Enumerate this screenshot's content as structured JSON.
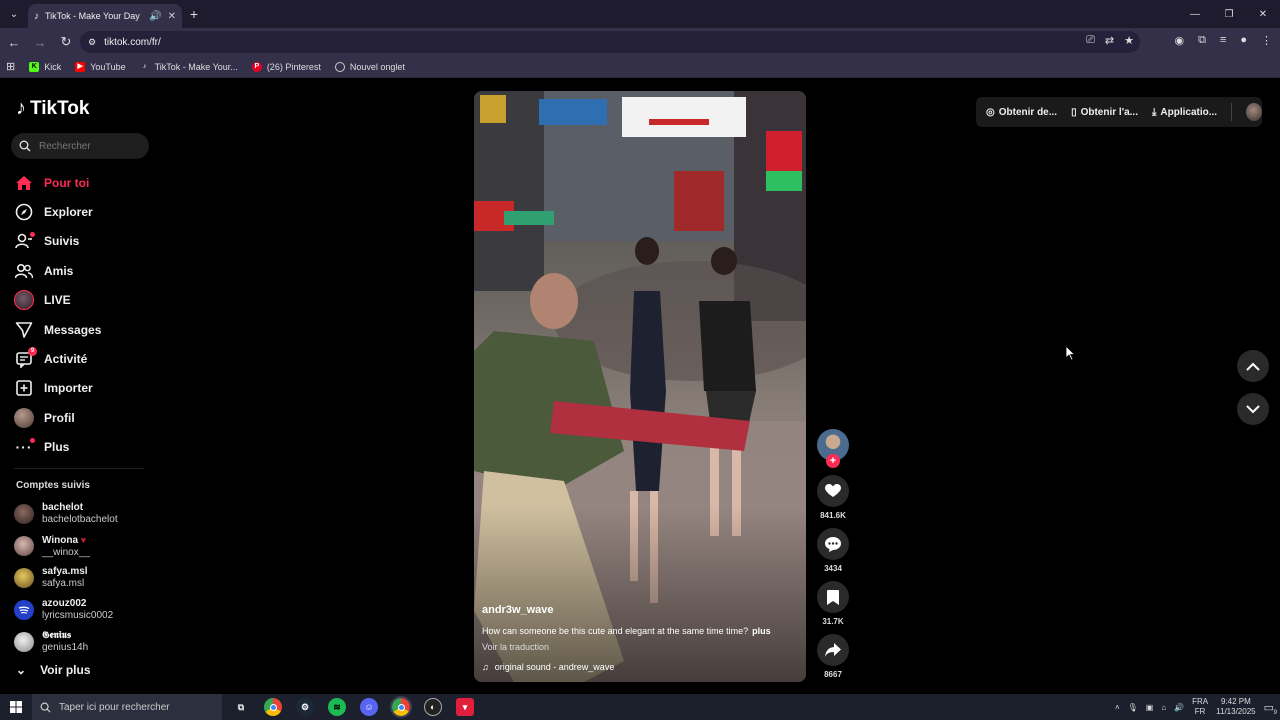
{
  "browser": {
    "tab_title": "TikTok - Make Your Day",
    "url": "tiktok.com/fr/",
    "bookmarks": [
      "Kick",
      "YouTube",
      "TikTok - Make Your...",
      "(26) Pinterest",
      "Nouvel onglet"
    ]
  },
  "sidebar": {
    "logo": "TikTok",
    "search_placeholder": "Rechercher",
    "items": [
      {
        "label": "Pour toi",
        "icon": "home-icon"
      },
      {
        "label": "Explorer",
        "icon": "compass-icon"
      },
      {
        "label": "Suivis",
        "icon": "following-icon"
      },
      {
        "label": "Amis",
        "icon": "friends-icon"
      },
      {
        "label": "LIVE",
        "icon": "live-icon"
      },
      {
        "label": "Messages",
        "icon": "messages-icon"
      },
      {
        "label": "Activité",
        "icon": "activity-icon",
        "badge": "9"
      },
      {
        "label": "Importer",
        "icon": "upload-icon"
      },
      {
        "label": "Profil",
        "icon": "profile-icon"
      },
      {
        "label": "Plus",
        "icon": "more-icon"
      }
    ],
    "following_title": "Comptes suivis",
    "following": [
      {
        "name": "bachelot",
        "handle": "bachelotbachelot"
      },
      {
        "name": "Winona",
        "handle": "__winox__"
      },
      {
        "name": "safya.msl",
        "handle": "safya.msl"
      },
      {
        "name": "azouz002",
        "handle": "lyricsmusic0002"
      },
      {
        "name": "𝕲𝖊𝖓𝖎𝖚𝖘",
        "handle": "genius14h"
      }
    ],
    "see_more": "Voir plus"
  },
  "video": {
    "username": "andr3w_wave",
    "caption": "How can someone be this cute and elegant at the same time time?",
    "more": "plus",
    "translate": "Voir la traduction",
    "sound": "original sound - andrew_wave"
  },
  "actions": {
    "likes": "841.6K",
    "comments": "3434",
    "saves": "31.7K",
    "shares": "8667"
  },
  "topbar": {
    "coins": "Obtenir de...",
    "app": "Obtenir l'a...",
    "application": "Applicatio..."
  },
  "taskbar": {
    "search": "Taper ici pour rechercher",
    "lang_top": "FRA",
    "lang_bottom": "FR",
    "time": "9:42 PM",
    "date": "11/13/2025",
    "notif": "9"
  },
  "colors": {
    "accent": "#fe2c55",
    "chrome": "#35304a"
  }
}
